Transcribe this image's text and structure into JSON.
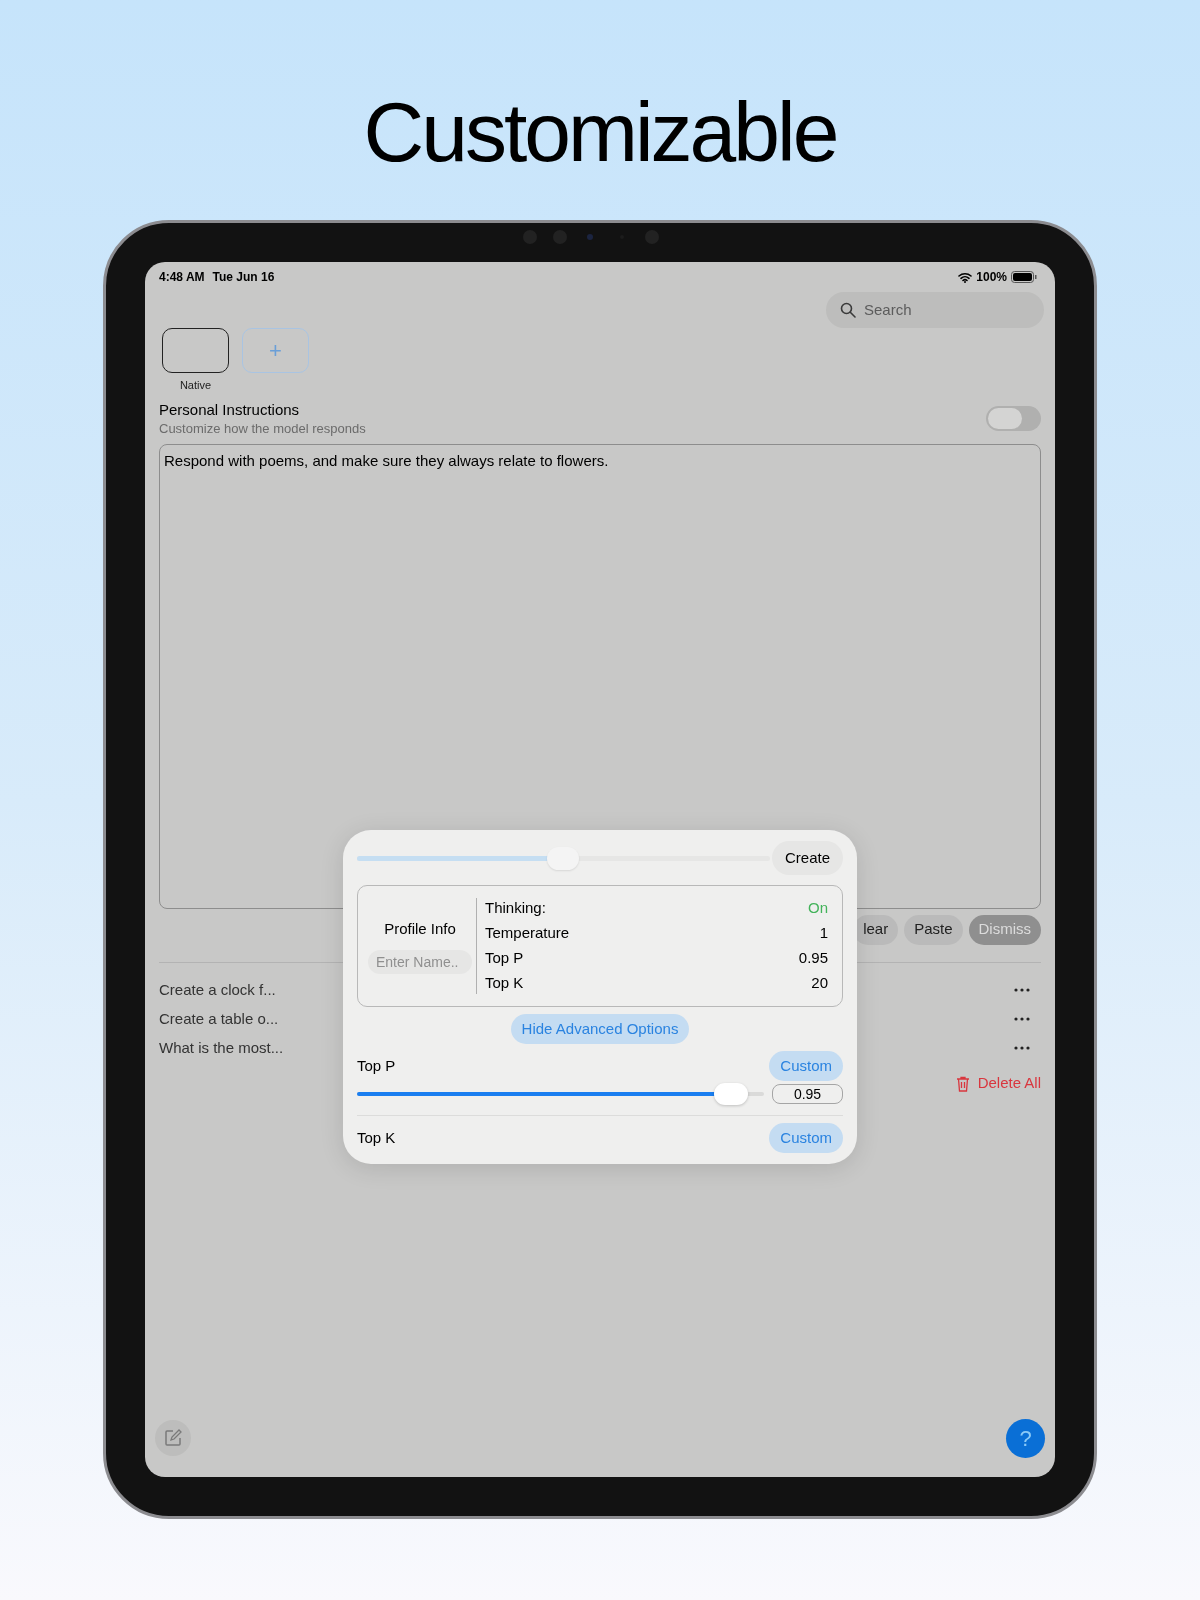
{
  "headline": "Customizable",
  "status_bar": {
    "time": "4:48 AM",
    "date": "Tue Jun 16",
    "battery": "100%"
  },
  "search": {
    "placeholder": "Search"
  },
  "profiles": [
    {
      "label": "Native",
      "selected": true
    }
  ],
  "add_profile": {
    "label": "+"
  },
  "personal_instructions": {
    "title": "Personal Instructions",
    "subtitle": "Customize how the model responds",
    "on": false,
    "text": "Respond with poems, and make sure they always relate to flowers."
  },
  "editor_buttons": [
    {
      "label": "lear",
      "kind": "plain"
    },
    {
      "label": "Paste",
      "kind": "plain"
    },
    {
      "label": "Dismiss",
      "kind": "dimmed"
    }
  ],
  "history": [
    {
      "title": "Create a clock f..."
    },
    {
      "title": "Create a table o..."
    },
    {
      "title": "What is the most..."
    }
  ],
  "delete_all": "Delete All",
  "help_button": "?",
  "sheet": {
    "progress": {
      "level": 0.5
    },
    "create": "Create",
    "profile_info": {
      "title": "Profile Info",
      "name_placeholder": "Enter Name.."
    },
    "settings": [
      {
        "label": "Thinking:",
        "value": "On",
        "kind": "status"
      },
      {
        "label": "Temperature",
        "value": "1",
        "kind": "plain"
      },
      {
        "label": "Top P",
        "value": "0.95",
        "kind": "plain"
      },
      {
        "label": "Top K",
        "value": "20",
        "kind": "plain"
      }
    ],
    "toggle_advanced": "Hide Advanced Options",
    "params": [
      {
        "label": "Top P",
        "mode": "Custom",
        "level": 0.92,
        "value": "0.95"
      },
      {
        "label": "Top K",
        "mode": "Custom"
      }
    ]
  }
}
